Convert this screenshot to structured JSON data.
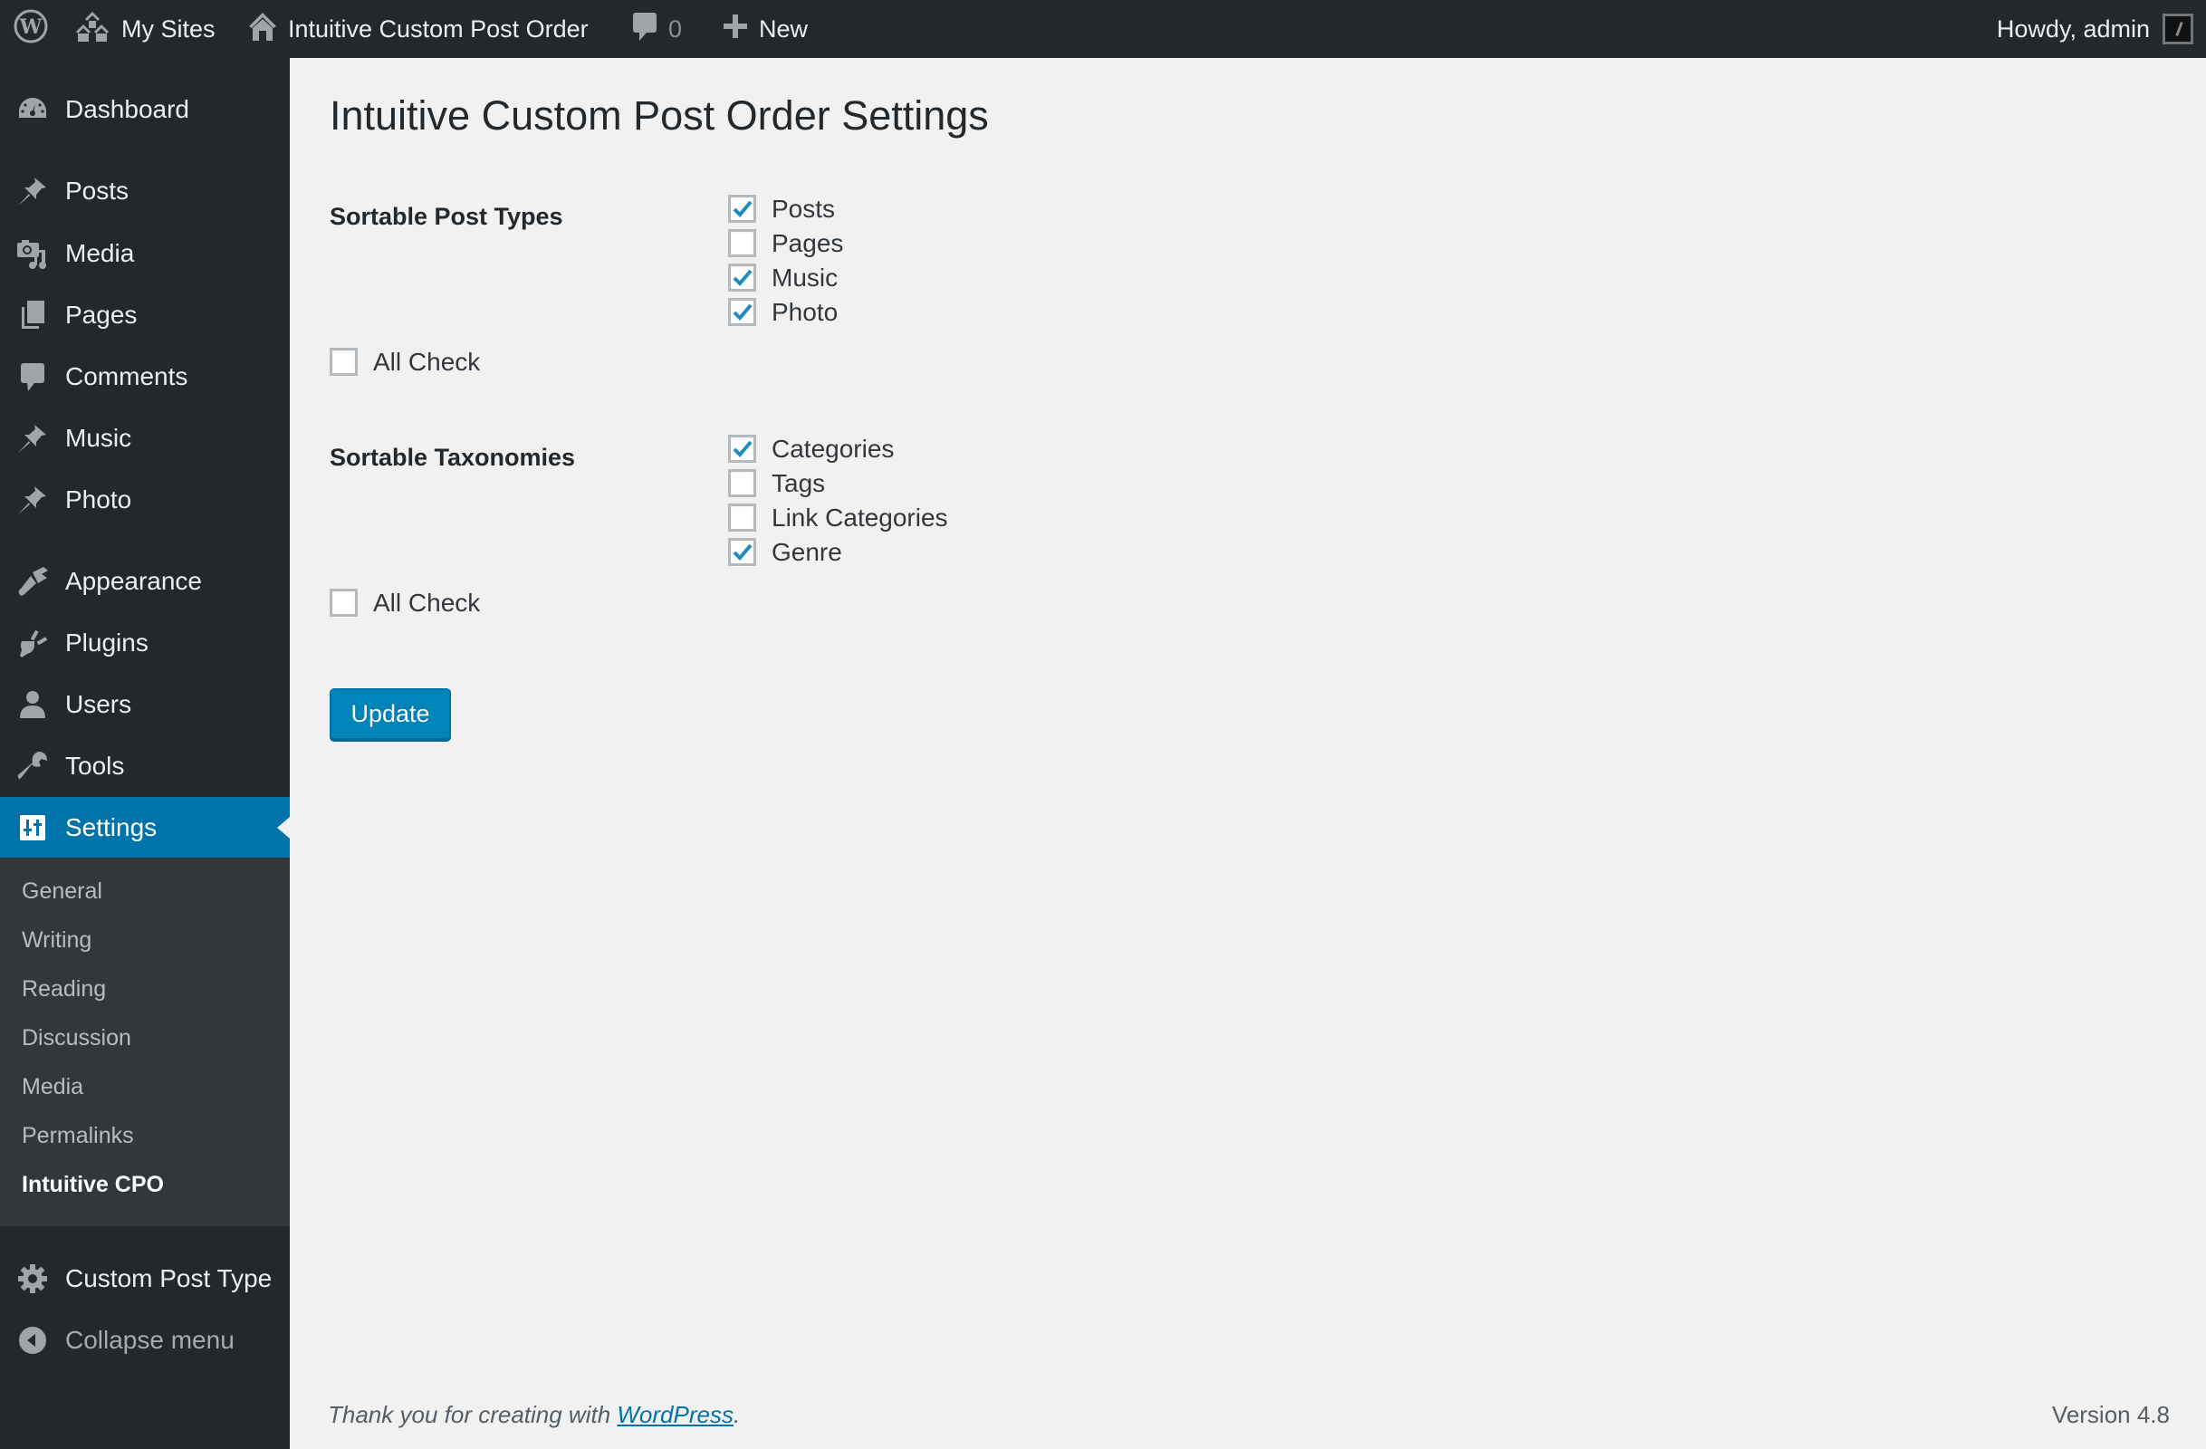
{
  "adminbar": {
    "wp_logo_icon": "wordpress-logo-icon",
    "my_sites": "My Sites",
    "site_name": "Intuitive Custom Post Order",
    "comments_count": "0",
    "new_label": "New",
    "howdy": "Howdy, admin"
  },
  "sidebar": {
    "items": [
      {
        "label": "Dashboard",
        "icon": "dashboard-icon"
      },
      {
        "label": "Posts",
        "icon": "pin-icon"
      },
      {
        "label": "Media",
        "icon": "media-icon"
      },
      {
        "label": "Pages",
        "icon": "pages-icon"
      },
      {
        "label": "Comments",
        "icon": "comment-icon"
      },
      {
        "label": "Music",
        "icon": "pin-icon"
      },
      {
        "label": "Photo",
        "icon": "pin-icon"
      },
      {
        "label": "Appearance",
        "icon": "paintbrush-icon"
      },
      {
        "label": "Plugins",
        "icon": "plugin-icon"
      },
      {
        "label": "Users",
        "icon": "user-icon"
      },
      {
        "label": "Tools",
        "icon": "wrench-icon"
      },
      {
        "label": "Settings",
        "icon": "settings-icon",
        "current": true
      },
      {
        "label": "Custom Post Type",
        "icon": "gear-icon"
      },
      {
        "label": "Collapse menu",
        "icon": "collapse-icon"
      }
    ],
    "submenu": [
      "General",
      "Writing",
      "Reading",
      "Discussion",
      "Media",
      "Permalinks",
      "Intuitive CPO"
    ],
    "submenu_current": "Intuitive CPO"
  },
  "page": {
    "title": "Intuitive Custom Post Order Settings",
    "post_types": {
      "label": "Sortable Post Types",
      "options": [
        {
          "label": "Posts",
          "checked": true
        },
        {
          "label": "Pages",
          "checked": false
        },
        {
          "label": "Music",
          "checked": true
        },
        {
          "label": "Photo",
          "checked": true
        }
      ],
      "all_check": {
        "label": "All Check",
        "checked": false
      }
    },
    "taxonomies": {
      "label": "Sortable Taxonomies",
      "options": [
        {
          "label": "Categories",
          "checked": true
        },
        {
          "label": "Tags",
          "checked": false
        },
        {
          "label": "Link Categories",
          "checked": false
        },
        {
          "label": "Genre",
          "checked": true
        }
      ],
      "all_check": {
        "label": "All Check",
        "checked": false
      }
    },
    "update_button": "Update"
  },
  "footer": {
    "thanks_prefix": "Thank you for creating with ",
    "link_text": "WordPress",
    "thanks_suffix": ".",
    "version": "Version 4.8"
  },
  "colors": {
    "accent": "#0073aa",
    "button": "#0085ba",
    "adminbar_bg": "#23282d",
    "submenu_bg": "#32373c",
    "content_bg": "#f1f1f1",
    "checkmark": "#1e8cbe"
  }
}
